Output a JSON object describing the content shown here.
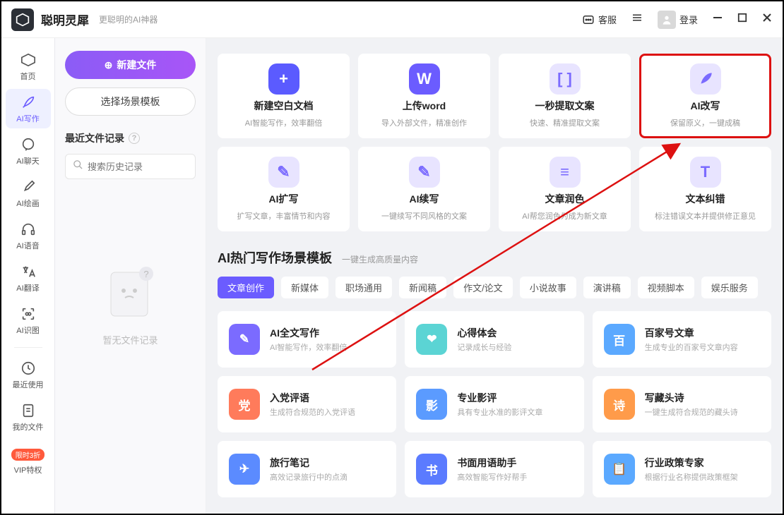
{
  "titlebar": {
    "app_name": "聪明灵犀",
    "app_sub": "更聪明的AI神器",
    "service": "客服",
    "login": "登录"
  },
  "sidebar": [
    {
      "label": "首页"
    },
    {
      "label": "AI写作"
    },
    {
      "label": "AI聊天"
    },
    {
      "label": "AI绘画"
    },
    {
      "label": "AI语音"
    },
    {
      "label": "AI翻译"
    },
    {
      "label": "AI识图"
    },
    {
      "label": "最近使用"
    },
    {
      "label": "我的文件"
    },
    {
      "label": "VIP特权"
    }
  ],
  "vip_badge": "限时3折",
  "left": {
    "new_file": "新建文件",
    "scene_tmpl": "选择场景模板",
    "recent": "最近文件记录",
    "search_ph": "搜索历史记录",
    "empty": "暂无文件记录"
  },
  "features": [
    {
      "title": "新建空白文档",
      "sub": "AI智能写作，效率翻倍",
      "bg": "#5b5bff",
      "glyph": "+"
    },
    {
      "title": "上传word",
      "sub": "导入外部文件，精准创作",
      "bg": "#6b5cff",
      "glyph": "W"
    },
    {
      "title": "一秒提取文案",
      "sub": "快速、精准提取文案",
      "bg": "#e8e4ff",
      "glyph": "[ ]"
    },
    {
      "title": "AI改写",
      "sub": "保留原义，一键成稿",
      "bg": "#e8e4ff",
      "glyph": "pen"
    },
    {
      "title": "AI扩写",
      "sub": "扩写文章，丰富情节和内容",
      "bg": "#e8e4ff",
      "glyph": "✎"
    },
    {
      "title": "AI续写",
      "sub": "一键续写不同风格的文案",
      "bg": "#e8e4ff",
      "glyph": "✎"
    },
    {
      "title": "文章润色",
      "sub": "AI帮您润色为成为新文章",
      "bg": "#e8e4ff",
      "glyph": "≡"
    },
    {
      "title": "文本纠错",
      "sub": "标注错误文本并提供修正意见",
      "bg": "#e8e4ff",
      "glyph": "T"
    }
  ],
  "section": {
    "title": "AI热门写作场景模板",
    "sub": "一键生成高质量内容"
  },
  "tabs": [
    "文章创作",
    "新媒体",
    "职场通用",
    "新闻稿",
    "作文/论文",
    "小说故事",
    "演讲稿",
    "视频脚本",
    "娱乐服务"
  ],
  "templates": [
    {
      "title": "AI全文写作",
      "sub": "AI智能写作，效率翻倍",
      "bg": "#7b6bff",
      "glyph": "✎"
    },
    {
      "title": "心得体会",
      "sub": "记录成长与经验",
      "bg": "#5bd4d4",
      "glyph": "❤"
    },
    {
      "title": "百家号文章",
      "sub": "生成专业的百家号文章内容",
      "bg": "#5ba9ff",
      "glyph": "百"
    },
    {
      "title": "入党评语",
      "sub": "生成符合规范的入党评语",
      "bg": "#ff7b5b",
      "glyph": "党"
    },
    {
      "title": "专业影评",
      "sub": "具有专业水准的影评文章",
      "bg": "#5b9bff",
      "glyph": "影"
    },
    {
      "title": "写藏头诗",
      "sub": "一键生成符合规范的藏头诗",
      "bg": "#ff9b4a",
      "glyph": "诗"
    },
    {
      "title": "旅行笔记",
      "sub": "高效记录旅行中的点滴",
      "bg": "#5b8bff",
      "glyph": "✈"
    },
    {
      "title": "书面用语助手",
      "sub": "高效智能写作好帮手",
      "bg": "#5b7bff",
      "glyph": "书"
    },
    {
      "title": "行业政策专家",
      "sub": "根据行业名称提供政策框架",
      "bg": "#5ba9ff",
      "glyph": "📋"
    }
  ],
  "colors": {
    "accent": "#6b5cff"
  }
}
